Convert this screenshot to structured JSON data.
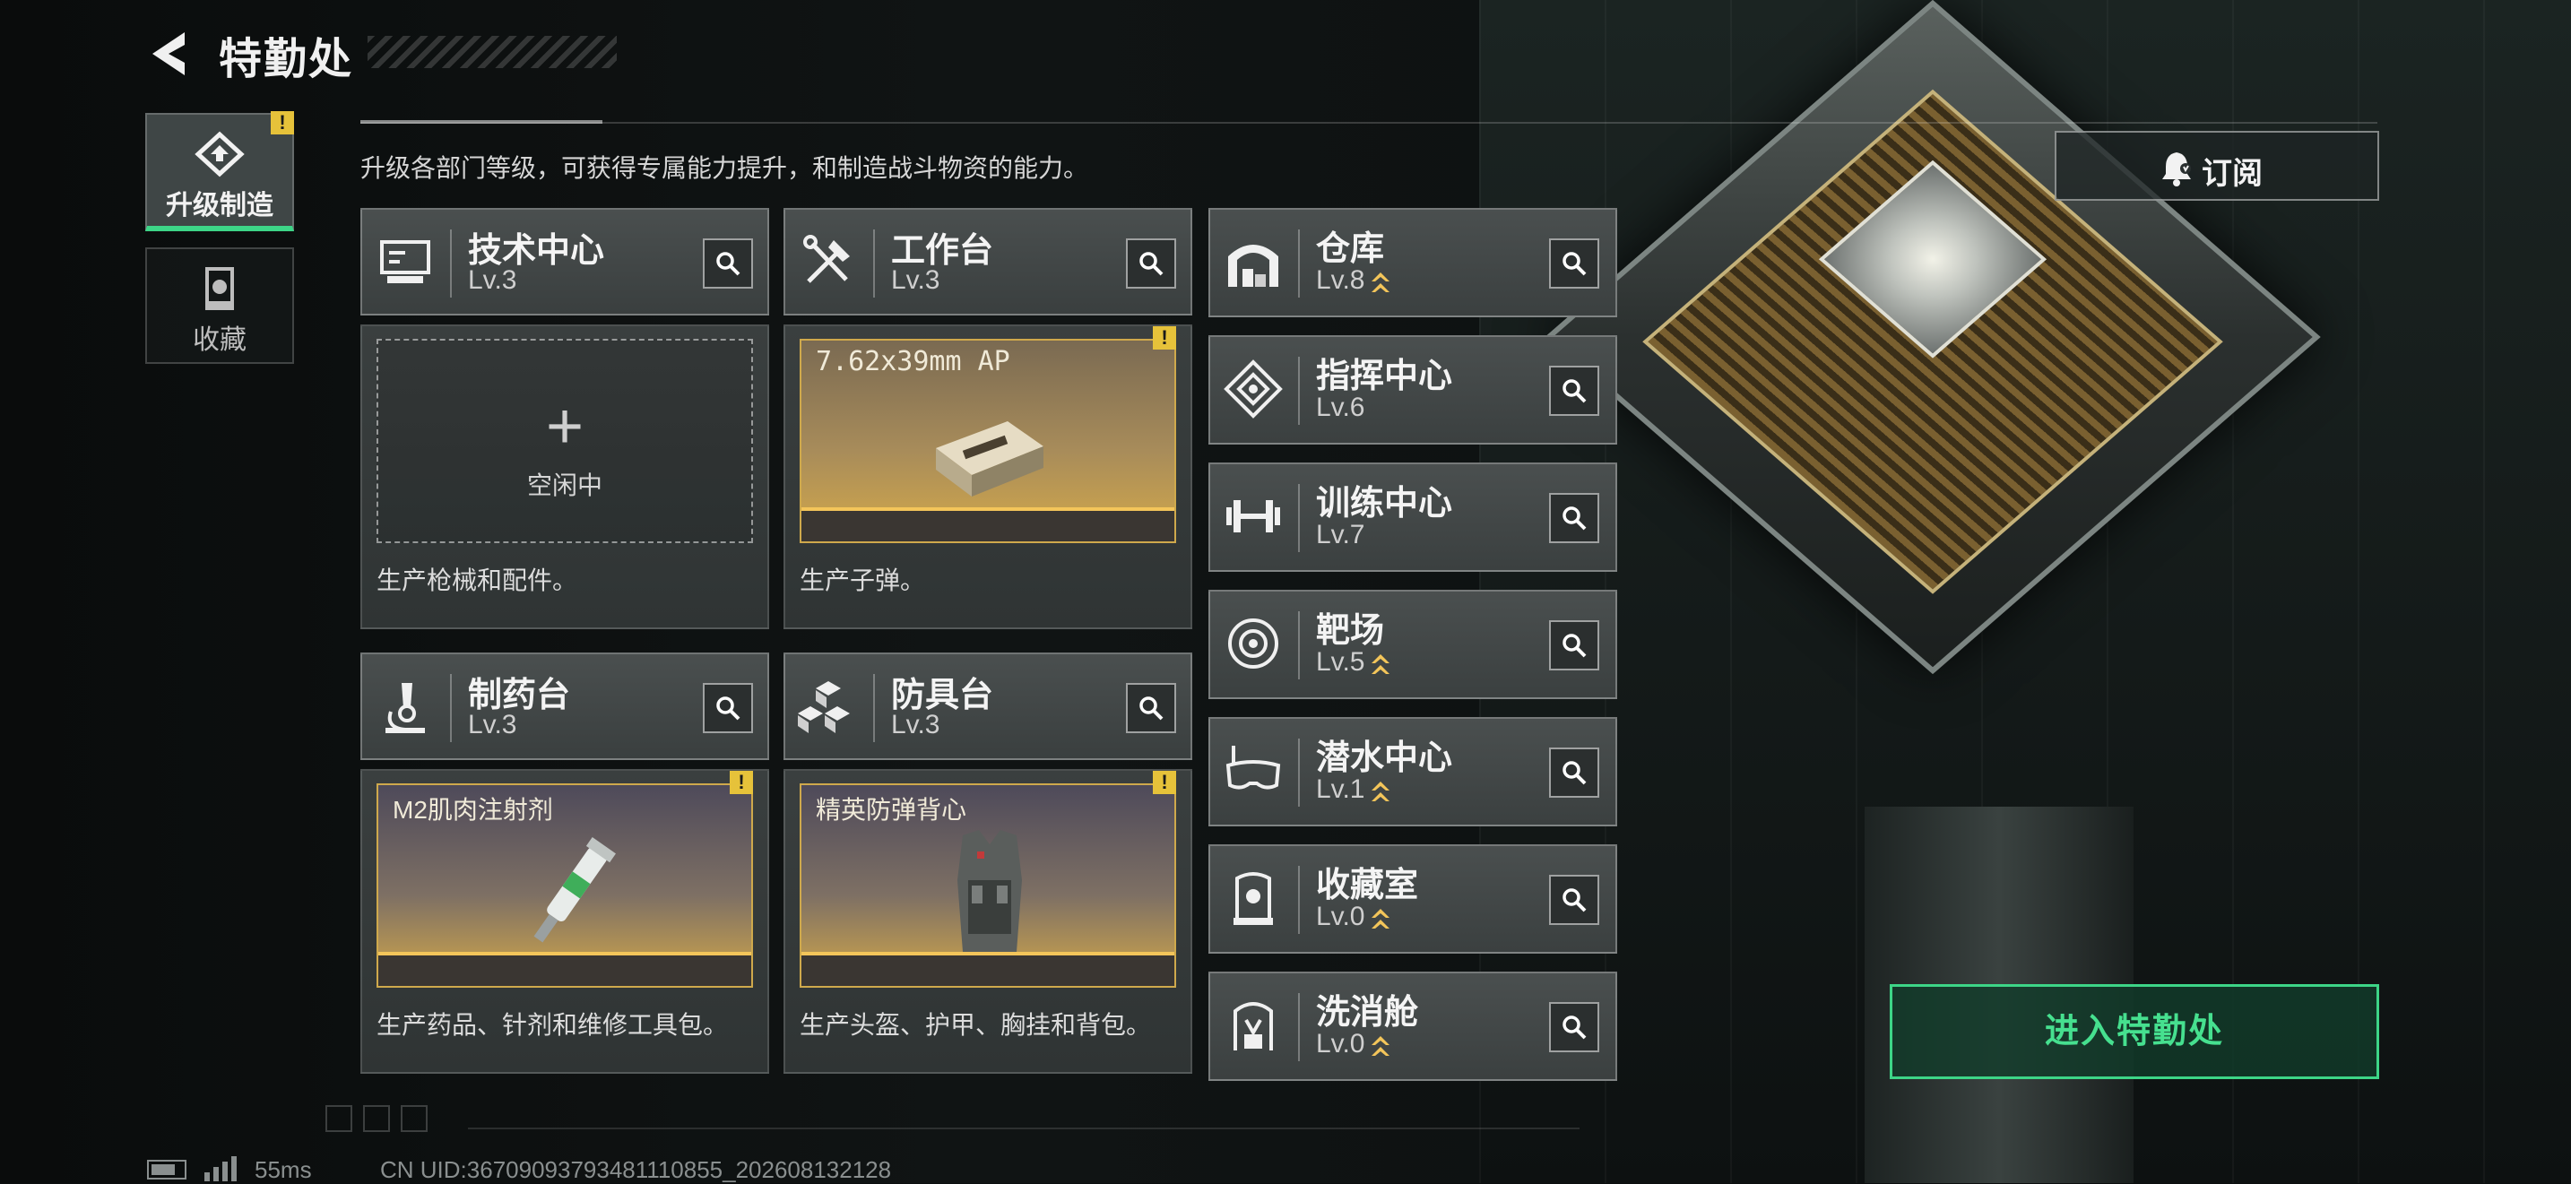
{
  "header": {
    "title": "特勤处",
    "subtitle": "升级各部门等级，可获得专属能力提升，和制造战斗物资的能力。"
  },
  "side_tabs": [
    {
      "label": "升级制造",
      "active": true,
      "warning": "!"
    },
    {
      "label": "收藏",
      "active": false
    }
  ],
  "departments": [
    {
      "name": "技术中心",
      "level": "Lv.3",
      "slot_state": "idle",
      "plus": "+",
      "idle_label": "空闲中",
      "desc": "生产枪械和配件。"
    },
    {
      "name": "工作台",
      "level": "Lv.3",
      "slot_item": "7.62x39mm AP",
      "warning": "!",
      "desc": "生产子弹。"
    },
    {
      "name": "制药台",
      "level": "Lv.3",
      "slot_item": "M2肌肉注射剂",
      "warning": "!",
      "desc": "生产药品、针剂和维修工具包。"
    },
    {
      "name": "防具台",
      "level": "Lv.3",
      "slot_item": "精英防弹背心",
      "warning": "!",
      "desc": "生产头盔、护甲、胸挂和背包。"
    }
  ],
  "facilities": [
    {
      "name": "仓库",
      "level": "Lv.8",
      "upgradable": true
    },
    {
      "name": "指挥中心",
      "level": "Lv.6",
      "upgradable": false
    },
    {
      "name": "训练中心",
      "level": "Lv.7",
      "upgradable": false
    },
    {
      "name": "靶场",
      "level": "Lv.5",
      "upgradable": true
    },
    {
      "name": "潜水中心",
      "level": "Lv.1",
      "upgradable": true
    },
    {
      "name": "收藏室",
      "level": "Lv.0",
      "upgradable": true
    },
    {
      "name": "洗消舱",
      "level": "Lv.0",
      "upgradable": true
    }
  ],
  "buttons": {
    "subscribe": "订阅",
    "enter": "进入特勤处"
  },
  "status_bar": {
    "ping": "55ms",
    "uid": "CN UID:36709093793481110855_202608132128"
  },
  "colors": {
    "accent_green": "#3dd587",
    "warning_yellow": "#e6c23a",
    "upgrade_chevron": "#f3c55a"
  }
}
